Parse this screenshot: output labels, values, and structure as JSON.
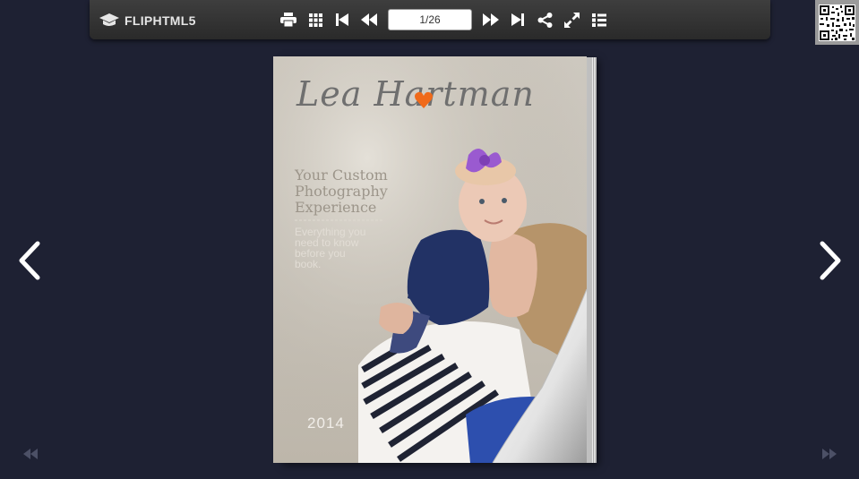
{
  "app": {
    "logo_text": "FLIPHTML5"
  },
  "toolbar": {
    "buttons": [
      {
        "name": "print-button",
        "icon": "print-icon"
      },
      {
        "name": "thumbnails-button",
        "icon": "grid-icon"
      },
      {
        "name": "first-page-button",
        "icon": "first-page-icon"
      },
      {
        "name": "previous-page-button",
        "icon": "rewind-icon"
      },
      {
        "name": "next-page-button",
        "icon": "fast-forward-icon"
      },
      {
        "name": "last-page-button",
        "icon": "last-page-icon"
      },
      {
        "name": "share-button",
        "icon": "share-icon"
      },
      {
        "name": "fullscreen-button",
        "icon": "expand-icon"
      },
      {
        "name": "table-of-contents-button",
        "icon": "list-icon"
      }
    ],
    "page_indicator": "1/26"
  },
  "qr": {
    "icon": "qr-code-icon"
  },
  "navigation": {
    "prev_icon": "chevron-left-icon",
    "next_icon": "chevron-right-icon",
    "first_icon": "double-chevron-left-icon",
    "last_icon": "double-chevron-right-icon"
  },
  "cover": {
    "brand_name": "Lea Hartman",
    "headline": [
      "Your Custom",
      "Photography",
      "Experience"
    ],
    "subline": [
      "Everything you",
      "need to know",
      "before you",
      "book."
    ],
    "year": "2014",
    "colors": {
      "heart": "#f06a1a",
      "background": "#1e2133",
      "toolbar": "#333333"
    }
  }
}
